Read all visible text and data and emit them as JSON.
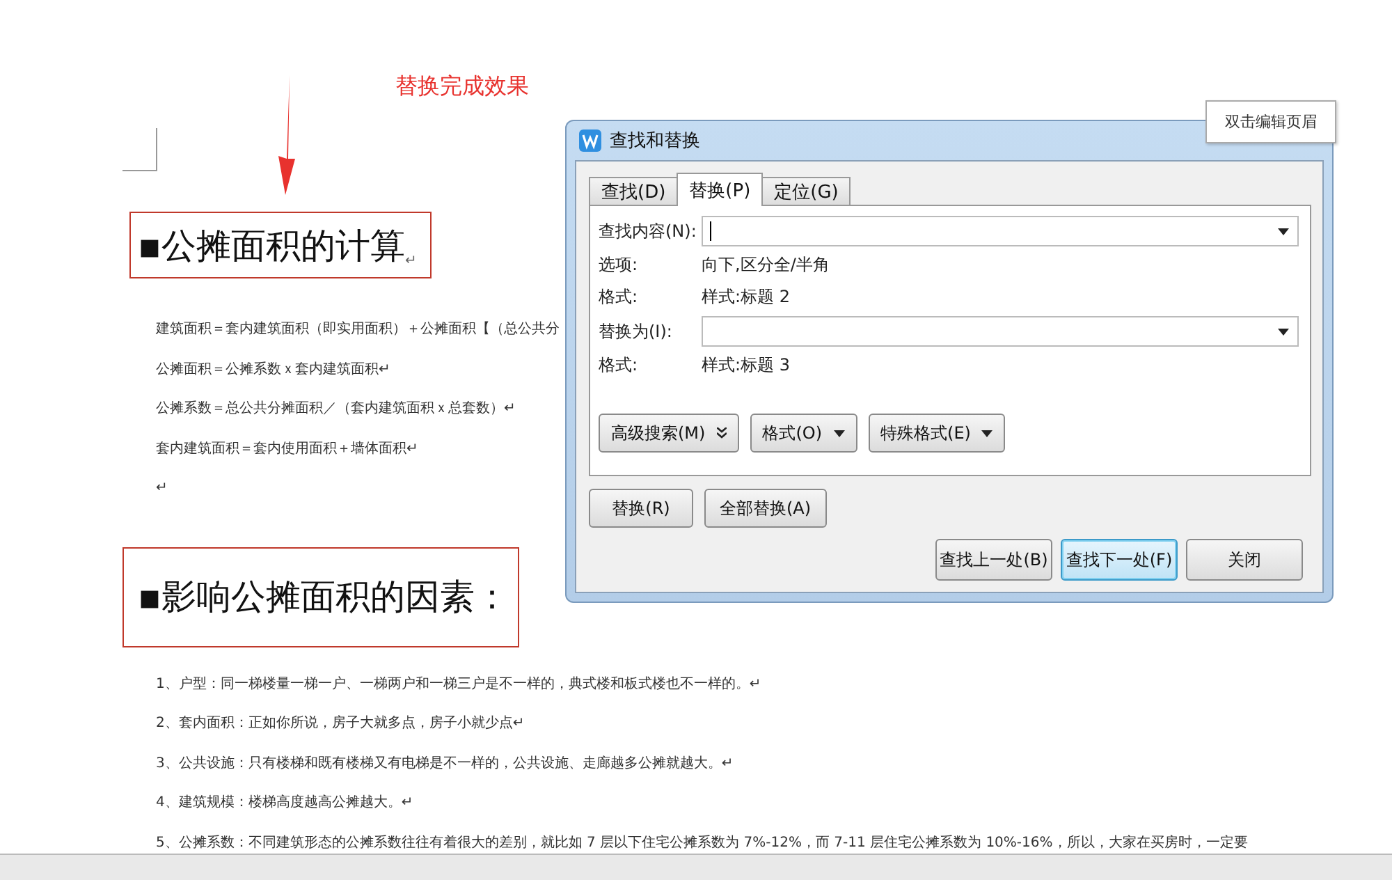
{
  "annotation": {
    "text": "替换完成效果"
  },
  "document": {
    "blocks": [
      {
        "kind": "heading",
        "text": "▪公摊面积的计算",
        "end_mark": "↵"
      },
      {
        "kind": "paragraph",
        "text": "建筑面积＝套内建筑面积（即实用面积）＋公摊面积【（总公共分"
      },
      {
        "kind": "paragraph",
        "text": "公摊面积＝公摊系数ｘ套内建筑面积↵"
      },
      {
        "kind": "paragraph",
        "text": "公摊系数＝总公共分摊面积／（套内建筑面积ｘ总套数）↵"
      },
      {
        "kind": "paragraph",
        "text": "套内建筑面积＝套内使用面积＋墙体面积↵"
      },
      {
        "kind": "paragraph",
        "text": "↵"
      },
      {
        "kind": "heading",
        "text": "▪影响公摊面积的因素："
      },
      {
        "kind": "paragraph",
        "text": "1、户型：同一梯楼量一梯一户、一梯两户和一梯三户是不一样的，典式楼和板式楼也不一样的。↵"
      },
      {
        "kind": "paragraph",
        "text": "2、套内面积：正如你所说，房子大就多点，房子小就少点↵"
      },
      {
        "kind": "paragraph",
        "text": "3、公共设施：只有楼梯和既有楼梯又有电梯是不一样的，公共设施、走廊越多公摊就越大。↵"
      },
      {
        "kind": "paragraph",
        "text": "4、建筑规模：楼梯高度越高公摊越大。↵"
      },
      {
        "kind": "paragraph",
        "text": "5、公摊系数：不同建筑形态的公摊系数往往有着很大的差别，就比如 7 层以下住宅公摊系数为 7%-12%，而 7-11 层住宅公摊系数为 10%-16%，所以，大家在买房时，一定要"
      }
    ]
  },
  "tooltip": {
    "text": "双击编辑页眉"
  },
  "dialog": {
    "title": "查找和替换",
    "tabs": [
      {
        "label": "查找(D)",
        "selected": false
      },
      {
        "label": "替换(P)",
        "selected": true
      },
      {
        "label": "定位(G)",
        "selected": false
      }
    ],
    "find": {
      "label": "查找内容(N):"
    },
    "find_info": [
      {
        "label": "选项:",
        "value": "向下,区分全/半角"
      },
      {
        "label": "格式:",
        "value": "样式:标题 2"
      }
    ],
    "replace": {
      "label": "替换为(I):"
    },
    "replace_info": [
      {
        "label": "格式:",
        "value": "样式:标题 3"
      }
    ],
    "option_buttons": [
      {
        "label": "高级搜索(M)",
        "kind": "expand"
      },
      {
        "label": "格式(O)",
        "kind": "menu"
      },
      {
        "label": "特殊格式(E)",
        "kind": "menu"
      }
    ],
    "replace_buttons": [
      {
        "label": "替换(R)"
      },
      {
        "label": "全部替换(A)"
      }
    ],
    "nav_buttons": [
      {
        "label": "查找上一处(B)",
        "default": false
      },
      {
        "label": "查找下一处(F)",
        "default": true
      },
      {
        "label": "关闭",
        "default": false
      }
    ]
  }
}
